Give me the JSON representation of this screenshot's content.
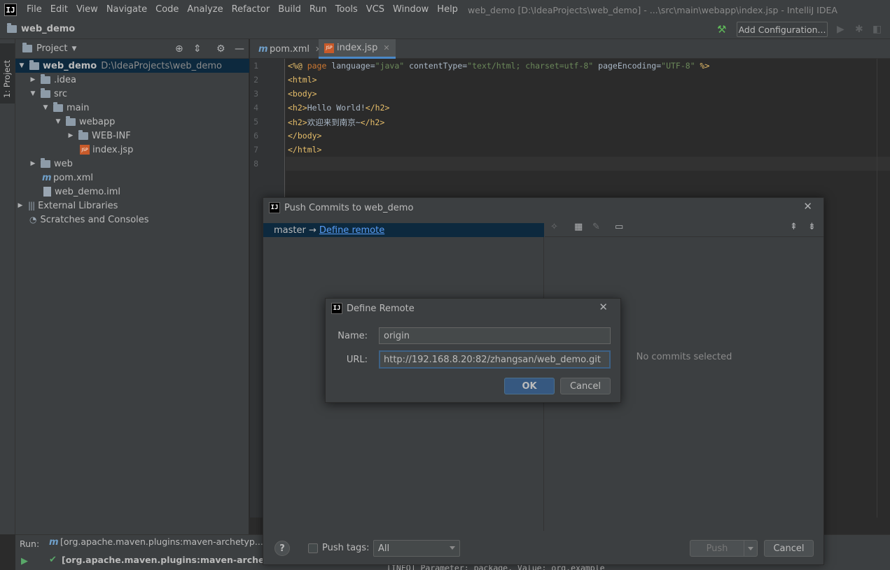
{
  "menubar": {
    "logo": "IJ",
    "items": [
      "File",
      "Edit",
      "View",
      "Navigate",
      "Code",
      "Analyze",
      "Refactor",
      "Build",
      "Run",
      "Tools",
      "VCS",
      "Window",
      "Help"
    ],
    "window_title": "web_demo [D:\\IdeaProjects\\web_demo] - ...\\src\\main\\webapp\\index.jsp - IntelliJ IDEA"
  },
  "navbar": {
    "project": "web_demo",
    "add_configuration": "Add Configuration..."
  },
  "toolstrip": {
    "project_tab": "1: Project"
  },
  "project_panel": {
    "title": "Project",
    "tree": [
      {
        "label": "web_demo",
        "path": "D:\\IdeaProjects\\web_demo"
      },
      {
        "label": ".idea"
      },
      {
        "label": "src"
      },
      {
        "label": "main"
      },
      {
        "label": "webapp"
      },
      {
        "label": "WEB-INF"
      },
      {
        "label": "index.jsp"
      },
      {
        "label": "web"
      },
      {
        "label": "pom.xml"
      },
      {
        "label": "web_demo.iml"
      },
      {
        "label": "External Libraries"
      },
      {
        "label": "Scratches and Consoles"
      }
    ]
  },
  "editor": {
    "tabs": [
      {
        "label": "pom.xml"
      },
      {
        "label": "index.jsp"
      }
    ],
    "line_numbers": [
      "1",
      "2",
      "3",
      "4",
      "5",
      "6",
      "7",
      "8"
    ],
    "code": {
      "l1_a": "<%@ ",
      "l1_b": "page ",
      "l1_c": "language=",
      "l1_d": "\"java\"",
      "l1_e": " contentType=",
      "l1_f": "\"text/html; charset=utf-8\"",
      "l1_g": " pageEncoding=",
      "l1_h": "\"UTF-8\"",
      "l1_i": " %>",
      "l2": "<html>",
      "l3": "<body>",
      "l4_open": "<h2>",
      "l4_text": "Hello World!",
      "l4_close": "</h2>",
      "l5_open": "<h2>",
      "l5_text": "欢迎来到南京~",
      "l5_close": "</h2>",
      "l6": "</body>",
      "l7": "</html>"
    }
  },
  "run_panel": {
    "label": "Run:",
    "tab": "[org.apache.maven.plugins:maven-archetyp...",
    "line": "[org.apache.maven.plugins:maven-archetype-p",
    "console": "[INFO] Parameter: package, Value: org.example"
  },
  "push_dialog": {
    "title": "Push Commits to web_demo",
    "branch": "master →",
    "define_remote_link": "Define remote",
    "no_commits": "No commits selected",
    "push_tags_label": "Push tags:",
    "push_tags_value": "All",
    "push_button": "Push",
    "cancel_button": "Cancel",
    "help": "?"
  },
  "define_remote_dialog": {
    "title": "Define Remote",
    "name_label": "Name:",
    "name_value": "origin",
    "url_label": "URL:",
    "url_value": "http://192.168.8.20:82/zhangsan/web_demo.git",
    "ok_button": "OK",
    "cancel_button": "Cancel"
  }
}
